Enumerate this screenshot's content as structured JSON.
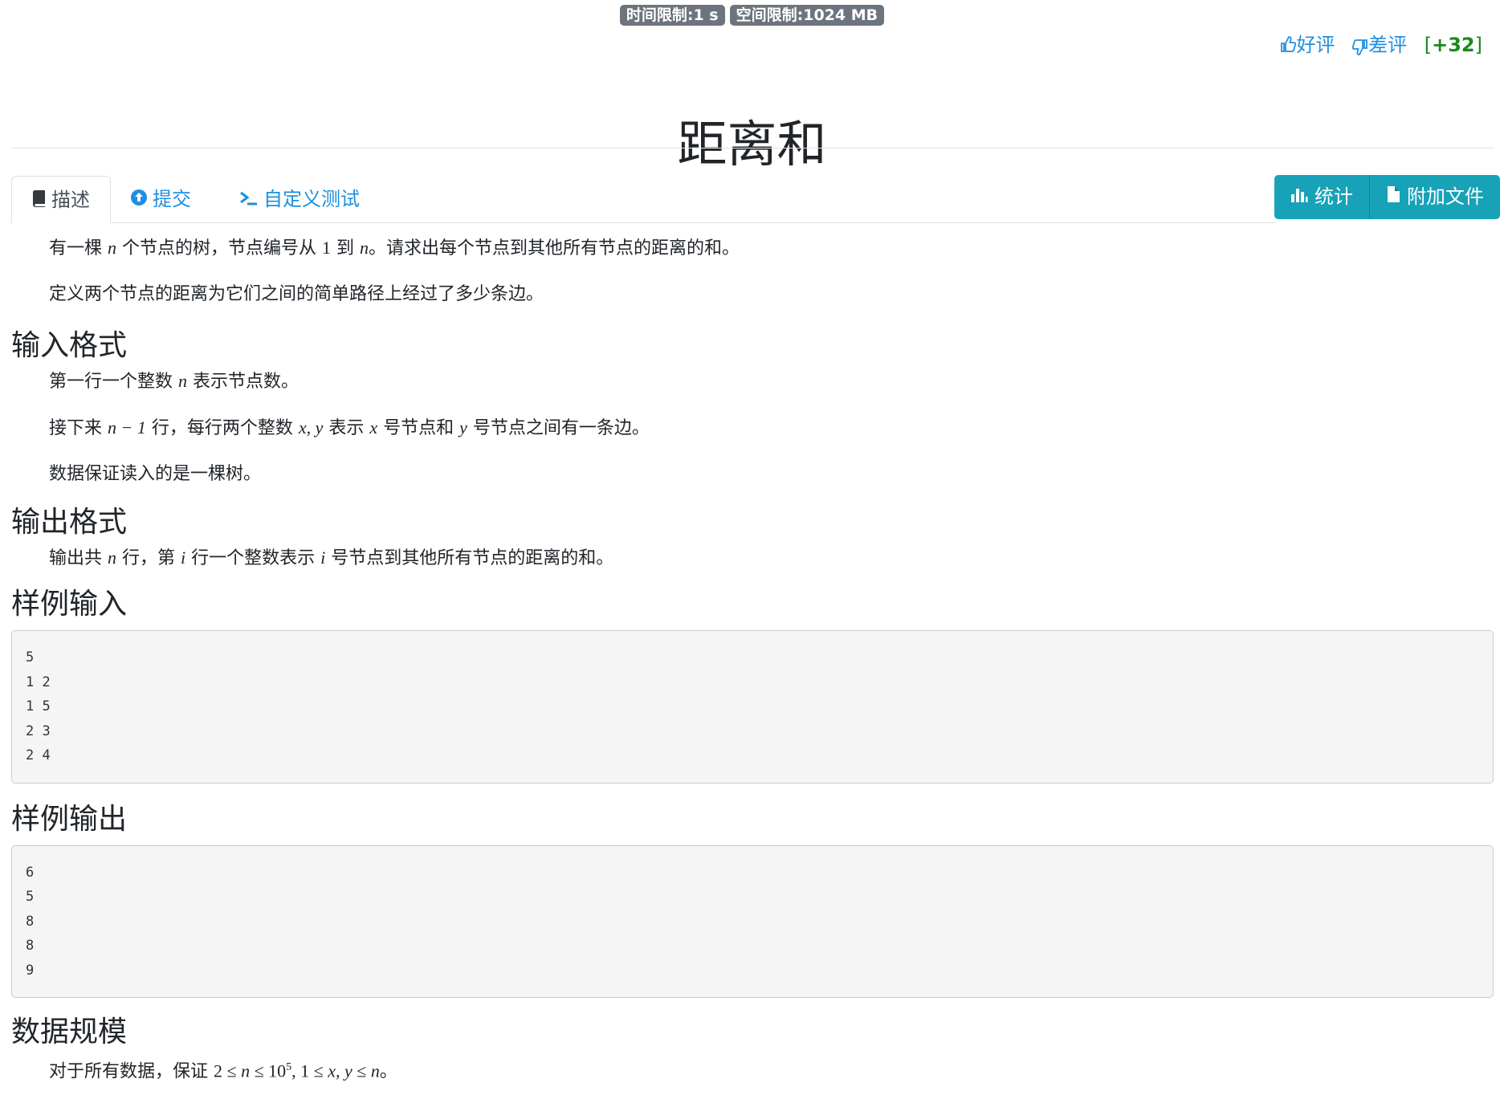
{
  "limits": {
    "time": "时间限制:1 s",
    "memory": "空间限制:1024 MB"
  },
  "rating": {
    "good": "好评",
    "bad": "差评",
    "score_open": "[",
    "score": "+32",
    "score_close": "]"
  },
  "title": "距离和",
  "tabs": [
    {
      "label": "描述",
      "icon": "book-icon"
    },
    {
      "label": "提交",
      "icon": "upload-circle-icon"
    },
    {
      "label": "自定义测试",
      "icon": "terminal-icon"
    }
  ],
  "actions": {
    "stats": "统计",
    "attachments": "附加文件"
  },
  "description": {
    "p1": {
      "a": "有一棵 ",
      "n1": "n",
      "b": " 个节点的树，节点编号从 ",
      "one": "1",
      "c": " 到 ",
      "n2": "n",
      "d": "。请求出每个节点到其他所有节点的距离的和。"
    },
    "p2": "定义两个节点的距离为它们之间的简单路径上经过了多少条边。"
  },
  "input_format": {
    "heading": "输入格式",
    "p1": {
      "a": "第一行一个整数 ",
      "n": "n",
      "b": " 表示节点数。"
    },
    "p2": {
      "a": "接下来 ",
      "expr": "n − 1",
      "b": " 行，每行两个整数 ",
      "xy": "x, y",
      "c": " 表示 ",
      "x": "x",
      "d": " 号节点和 ",
      "y": "y",
      "e": " 号节点之间有一条边。"
    },
    "p3": "数据保证读入的是一棵树。"
  },
  "output_format": {
    "heading": "输出格式",
    "p1": {
      "a": "输出共 ",
      "n": "n",
      "b": " 行，第 ",
      "i1": "i",
      "c": " 行一个整数表示 ",
      "i2": "i",
      "d": " 号节点到其他所有节点的距离的和。"
    }
  },
  "sample_input": {
    "heading": "样例输入",
    "content": "5\n1 2\n1 5\n2 3\n2 4"
  },
  "sample_output": {
    "heading": "样例输出",
    "content": "6\n5\n8\n8\n9"
  },
  "constraints": {
    "heading": "数据规模",
    "p1": {
      "a": "对于所有数据，保证 ",
      "two": "2",
      "le1": " ≤ ",
      "n": "n",
      "le2": " ≤ ",
      "ten": "10",
      "exp": "5",
      "comma": ", ",
      "one": "1",
      "le3": " ≤ ",
      "xy": "x, y",
      "le4": " ≤ ",
      "n2": "n",
      "end": "。"
    }
  }
}
